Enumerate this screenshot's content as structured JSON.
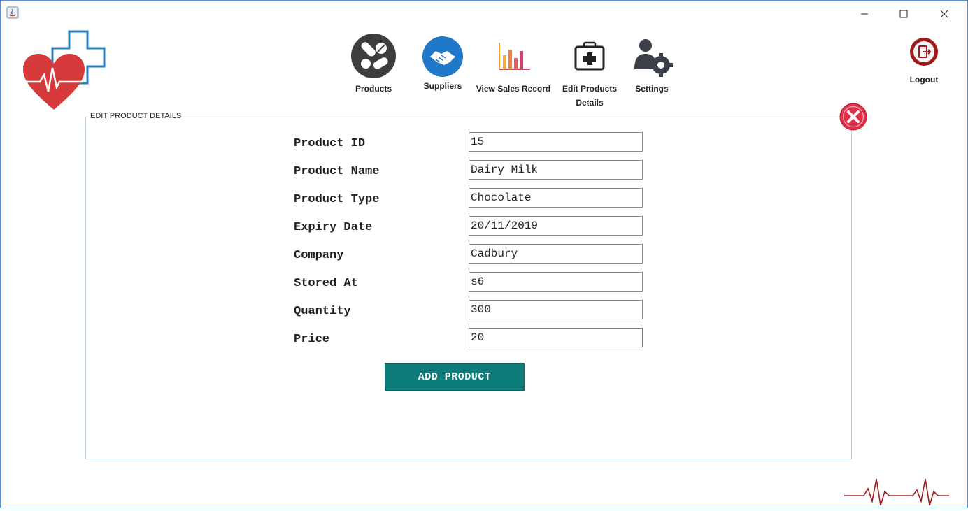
{
  "window": {
    "minimize_glyph": "—",
    "maximize_glyph": "☐",
    "close_glyph": "✕"
  },
  "nav": {
    "products": "Products",
    "suppliers": "Suppliers",
    "sales": "View Sales Record",
    "edit_line1": "Edit Products",
    "edit_line2": "Details",
    "settings": "Settings"
  },
  "logout": {
    "label": "Logout"
  },
  "panel": {
    "title": "EDIT PRODUCT DETAILS"
  },
  "form": {
    "fields": [
      {
        "label": "Product ID",
        "value": "15"
      },
      {
        "label": "Product Name",
        "value": "Dairy Milk"
      },
      {
        "label": "Product Type",
        "value": "Chocolate"
      },
      {
        "label": "Expiry Date",
        "value": "20/11/2019"
      },
      {
        "label": "Company",
        "value": "Cadbury"
      },
      {
        "label": "Stored At",
        "value": "s6"
      },
      {
        "label": "Quantity",
        "value": "300"
      },
      {
        "label": "Price",
        "value": "20"
      }
    ],
    "submit_label": "ADD PRODUCT"
  },
  "colors": {
    "accent": "#0d7c7b",
    "heart": "#d63a3a",
    "close_red": "#e0304a",
    "logout_red": "#a01c1c",
    "supplier_blue": "#1f78c8"
  },
  "icons": {
    "products": "pills-icon",
    "suppliers": "handshake-icon",
    "sales": "bar-chart-icon",
    "edit": "medical-kit-icon",
    "settings": "user-gear-icon",
    "logout": "logout-icon",
    "close": "close-circle-icon"
  }
}
